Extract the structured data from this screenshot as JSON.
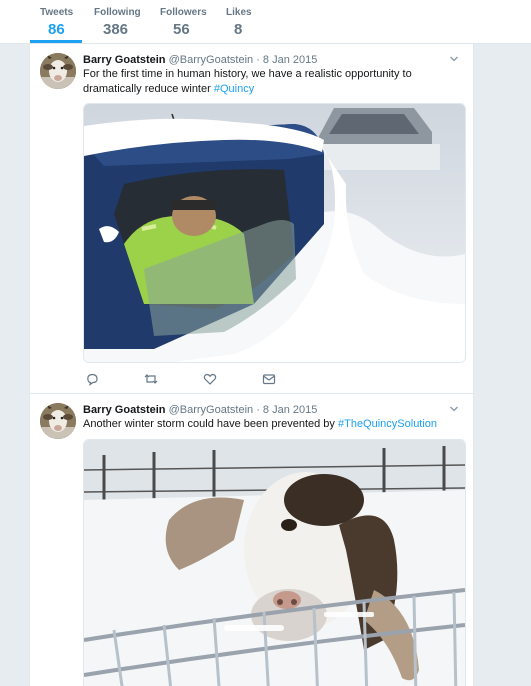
{
  "stats": [
    {
      "label": "Tweets",
      "value": "86",
      "active": true
    },
    {
      "label": "Following",
      "value": "386",
      "active": false
    },
    {
      "label": "Followers",
      "value": "56",
      "active": false
    },
    {
      "label": "Likes",
      "value": "8",
      "active": false
    }
  ],
  "colors": {
    "accent": "#1da1f2",
    "muted": "#657786",
    "border": "#e1e8ed",
    "background": "#e6ecf0"
  },
  "tweets": [
    {
      "name": "Barry Goatstein",
      "handle": "@BarryGoatstein",
      "date": "8 Jan 2015",
      "text": "For the first time in human history, we have a realistic opportunity to dramatically reduce winter ",
      "hashtag": "#Quincy",
      "media": "snow-covered car with man in hi-vis jacket looking through window",
      "actions": [
        "reply-icon",
        "retweet-icon",
        "like-icon",
        "message-icon"
      ]
    },
    {
      "name": "Barry Goatstein",
      "handle": "@BarryGoatstein",
      "date": "8 Jan 2015",
      "text": "Another winter storm could have been prevented by ",
      "hashtag": "#TheQuincySolution",
      "media": "goat with snowy face poking head through icy metal fence"
    }
  ]
}
